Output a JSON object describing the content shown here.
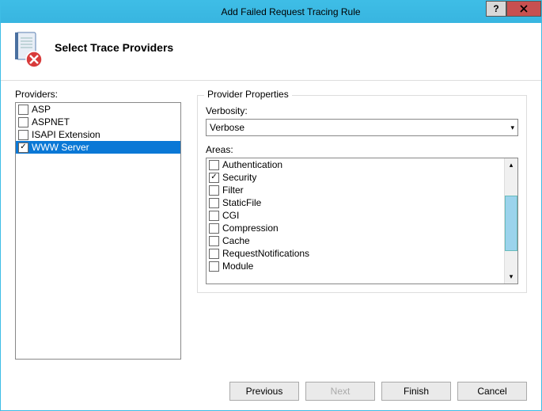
{
  "title": "Add Failed Request Tracing Rule",
  "header": {
    "title": "Select Trace Providers"
  },
  "left": {
    "label": "Providers:",
    "items": [
      {
        "label": "ASP",
        "checked": false,
        "selected": false
      },
      {
        "label": "ASPNET",
        "checked": false,
        "selected": false
      },
      {
        "label": "ISAPI Extension",
        "checked": false,
        "selected": false
      },
      {
        "label": "WWW Server",
        "checked": true,
        "selected": true
      }
    ]
  },
  "right": {
    "group_title": "Provider Properties",
    "verbosity_label": "Verbosity:",
    "verbosity_value": "Verbose",
    "areas_label": "Areas:",
    "areas": [
      {
        "label": "Authentication",
        "checked": false
      },
      {
        "label": "Security",
        "checked": true
      },
      {
        "label": "Filter",
        "checked": false
      },
      {
        "label": "StaticFile",
        "checked": false
      },
      {
        "label": "CGI",
        "checked": false
      },
      {
        "label": "Compression",
        "checked": false
      },
      {
        "label": "Cache",
        "checked": false
      },
      {
        "label": "RequestNotifications",
        "checked": false
      },
      {
        "label": "Module",
        "checked": false
      }
    ]
  },
  "footer": {
    "previous": "Previous",
    "next": "Next",
    "finish": "Finish",
    "cancel": "Cancel"
  }
}
